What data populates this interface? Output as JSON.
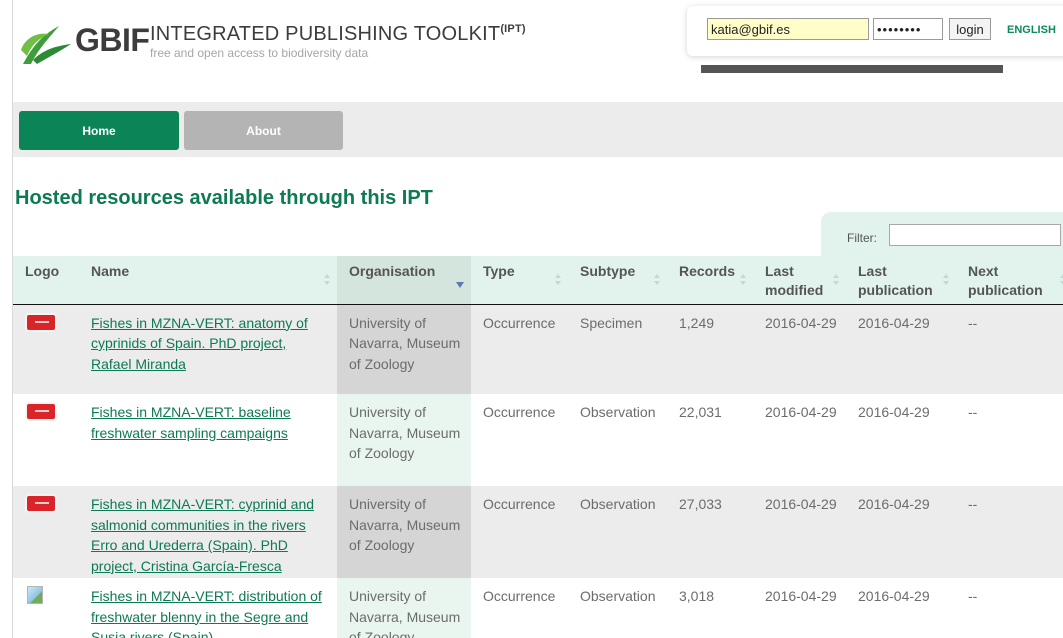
{
  "header": {
    "brand": "GBIF",
    "title": "INTEGRATED PUBLISHING TOOLKIT",
    "title_sup": "(IPT)",
    "tagline": "free and open access to biodiversity data"
  },
  "login": {
    "email": "katia@gbif.es",
    "password": "••••••••",
    "button": "login",
    "language": "ENGLISH"
  },
  "nav": [
    {
      "label": "Home",
      "active": true
    },
    {
      "label": "About",
      "active": false
    }
  ],
  "main": {
    "heading": "Hosted resources available through this IPT",
    "filter_label": "Filter:",
    "filter_value": ""
  },
  "table": {
    "columns": [
      "Logo",
      "Name",
      "Organisation",
      "Type",
      "Subtype",
      "Records",
      "Last modified",
      "Last publication",
      "Next publication"
    ],
    "rows": [
      {
        "logo": "resource-logo",
        "name": "Fishes in MZNA-VERT: anatomy of cyprinids of Spain. PhD project, Rafael Miranda",
        "organisation": "University of Navarra, Museum of Zoology",
        "type": "Occurrence",
        "subtype": "Specimen",
        "records": "1,249",
        "last_modified": "2016-04-29",
        "last_publication": "2016-04-29",
        "next_publication": "--"
      },
      {
        "logo": "resource-logo",
        "name": "Fishes in MZNA-VERT: baseline freshwater sampling campaigns",
        "organisation": "University of Navarra, Museum of Zoology",
        "type": "Occurrence",
        "subtype": "Observation",
        "records": "22,031",
        "last_modified": "2016-04-29",
        "last_publication": "2016-04-29",
        "next_publication": "--"
      },
      {
        "logo": "resource-logo",
        "name": "Fishes in MZNA-VERT: cyprinid and salmonid communities in the rivers Erro and Urederra (Spain). PhD project, Cristina García-Fresca",
        "organisation": "University of Navarra, Museum of Zoology",
        "type": "Occurrence",
        "subtype": "Observation",
        "records": "27,033",
        "last_modified": "2016-04-29",
        "last_publication": "2016-04-29",
        "next_publication": "--"
      },
      {
        "logo": "broken-image",
        "name": "Fishes in MZNA-VERT: distribution of freshwater blenny in the Segre and Susia rivers (Spain)",
        "organisation": "University of Navarra, Museum of Zoology",
        "type": "Occurrence",
        "subtype": "Observation",
        "records": "3,018",
        "last_modified": "2016-04-29",
        "last_publication": "2016-04-29",
        "next_publication": "--"
      }
    ]
  },
  "colors": {
    "brand_green": "#0b8457",
    "heading_green": "#0c7a52",
    "table_header_bg": "#e1f3ec",
    "nav_inactive": "#b4b4b4"
  }
}
